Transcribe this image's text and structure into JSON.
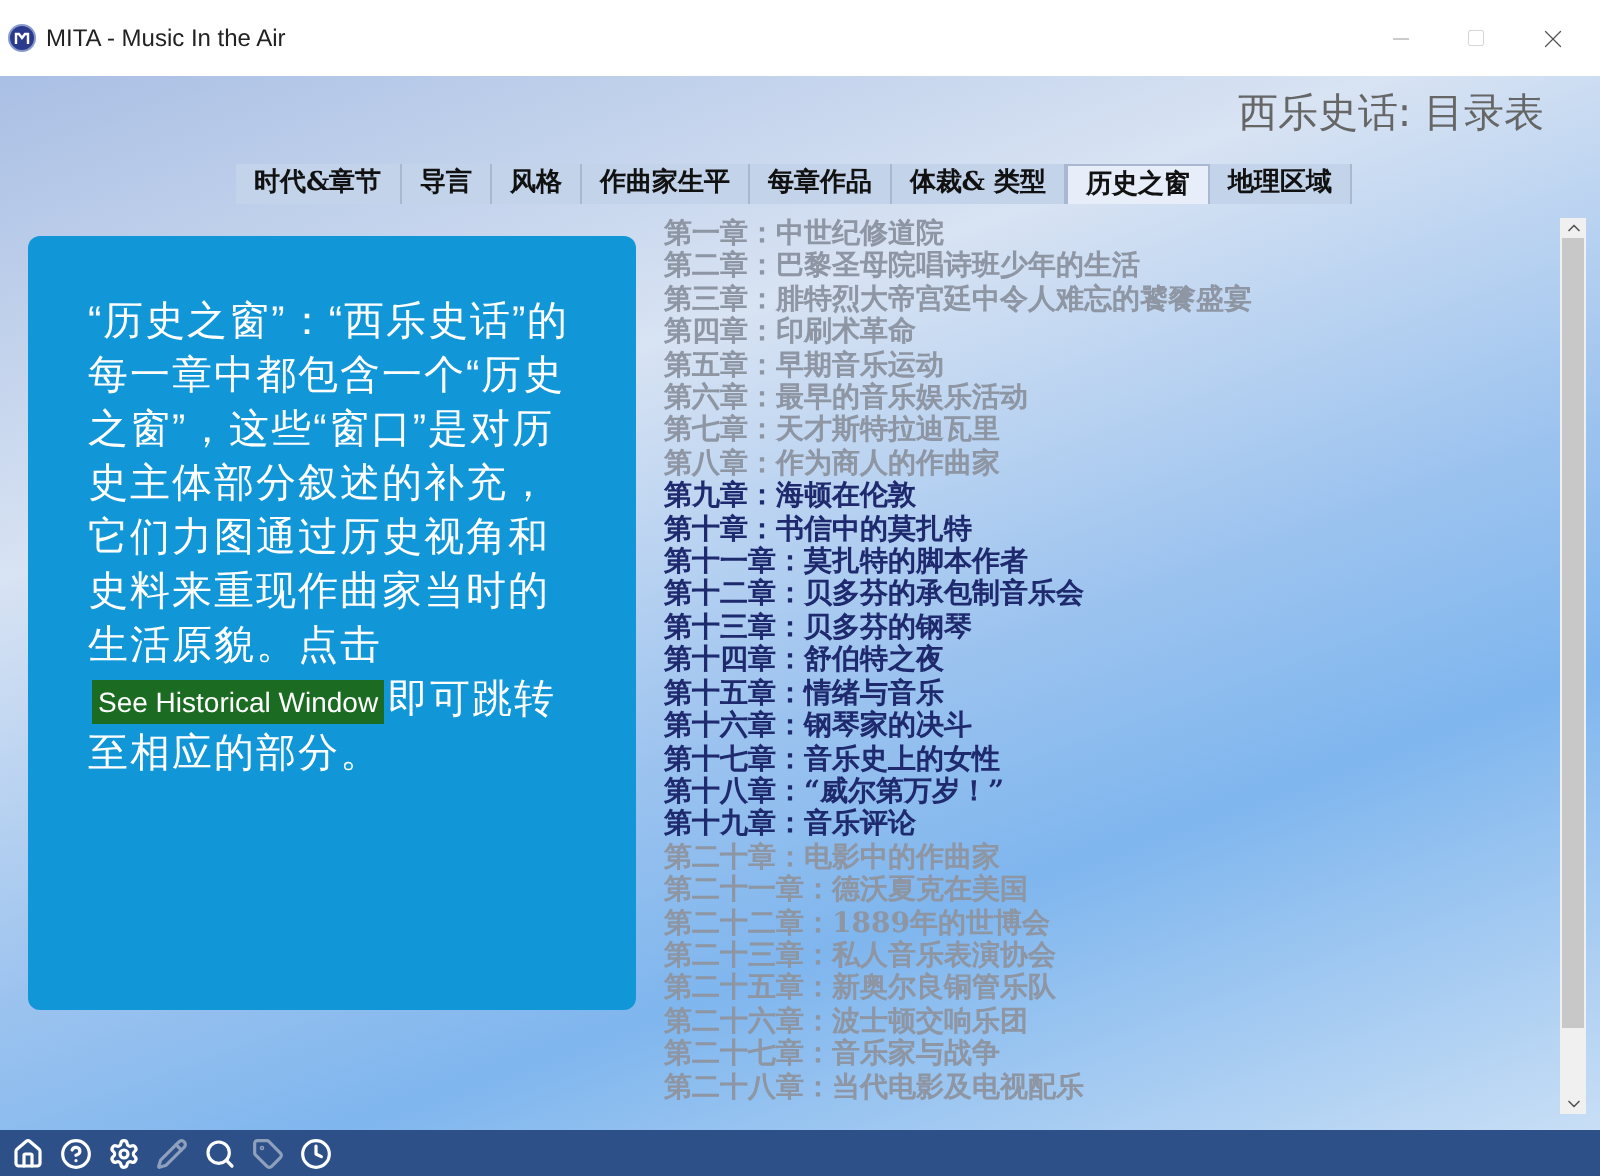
{
  "window": {
    "title": "MITA - Music In the Air"
  },
  "page_title": "西乐史话: 目录表",
  "tabs": [
    {
      "label": "时代&章节",
      "selected": false
    },
    {
      "label": "导言",
      "selected": false
    },
    {
      "label": "风格",
      "selected": false
    },
    {
      "label": "作曲家生平",
      "selected": false
    },
    {
      "label": "每章作品",
      "selected": false
    },
    {
      "label": "体裁& 类型",
      "selected": false
    },
    {
      "label": "历史之窗",
      "selected": true
    },
    {
      "label": "地理区域",
      "selected": false
    }
  ],
  "info_card": {
    "text_before": "“历史之窗”：“西乐史话”的每一章中都包含一个“历史之窗”，这些“窗口”是对历史主体部分叙述的补充，它们力图通过历史视角和史料来重现作曲家当时的生活原貌。点击",
    "link": "See Historical Window",
    "text_after": "即可跳转至相应的部分。"
  },
  "chapters": [
    {
      "label": "第一章：中世纪修道院",
      "enabled": false
    },
    {
      "label": "第二章：巴黎圣母院唱诗班少年的生活",
      "enabled": false
    },
    {
      "label": "第三章：腓特烈大帝宫廷中令人难忘的饕餮盛宴",
      "enabled": false
    },
    {
      "label": "第四章：印刷术革命",
      "enabled": false
    },
    {
      "label": "第五章：早期音乐运动",
      "enabled": false
    },
    {
      "label": "第六章：最早的音乐娱乐活动",
      "enabled": false
    },
    {
      "label": "第七章：天才斯特拉迪瓦里",
      "enabled": false
    },
    {
      "label": "第八章：作为商人的作曲家",
      "enabled": false
    },
    {
      "label": "第九章：海顿在伦敦",
      "enabled": true
    },
    {
      "label": "第十章：书信中的莫扎特",
      "enabled": true
    },
    {
      "label": "第十一章：莫扎特的脚本作者",
      "enabled": true
    },
    {
      "label": "第十二章：贝多芬的承包制音乐会",
      "enabled": true
    },
    {
      "label": "第十三章：贝多芬的钢琴",
      "enabled": true
    },
    {
      "label": "第十四章：舒伯特之夜",
      "enabled": true
    },
    {
      "label": "第十五章：情绪与音乐",
      "enabled": true
    },
    {
      "label": "第十六章：钢琴家的决斗",
      "enabled": true
    },
    {
      "label": "第十七章：音乐史上的女性",
      "enabled": true
    },
    {
      "label": "第十八章：“威尔第万岁！”",
      "enabled": true
    },
    {
      "label": "第十九章：音乐评论",
      "enabled": true
    },
    {
      "label": "第二十章：电影中的作曲家",
      "enabled": false
    },
    {
      "label": "第二十一章：德沃夏克在美国",
      "enabled": false
    },
    {
      "label": "第二十二章：1889年的世博会",
      "enabled": false
    },
    {
      "label": "第二十三章：私人音乐表演协会",
      "enabled": false
    },
    {
      "label": "第二十五章：新奥尔良铜管乐队",
      "enabled": false
    },
    {
      "label": "第二十六章：波士顿交响乐团",
      "enabled": false
    },
    {
      "label": "第二十七章：音乐家与战争",
      "enabled": false
    },
    {
      "label": "第二十八章：当代电影及电视配乐",
      "enabled": false
    }
  ],
  "toolbar": [
    {
      "kind": "home",
      "disabled": false
    },
    {
      "kind": "help",
      "disabled": false
    },
    {
      "kind": "settings",
      "disabled": false
    },
    {
      "kind": "pencil",
      "disabled": true
    },
    {
      "kind": "search",
      "disabled": false
    },
    {
      "kind": "tag",
      "disabled": true
    },
    {
      "kind": "clock",
      "disabled": false
    }
  ]
}
